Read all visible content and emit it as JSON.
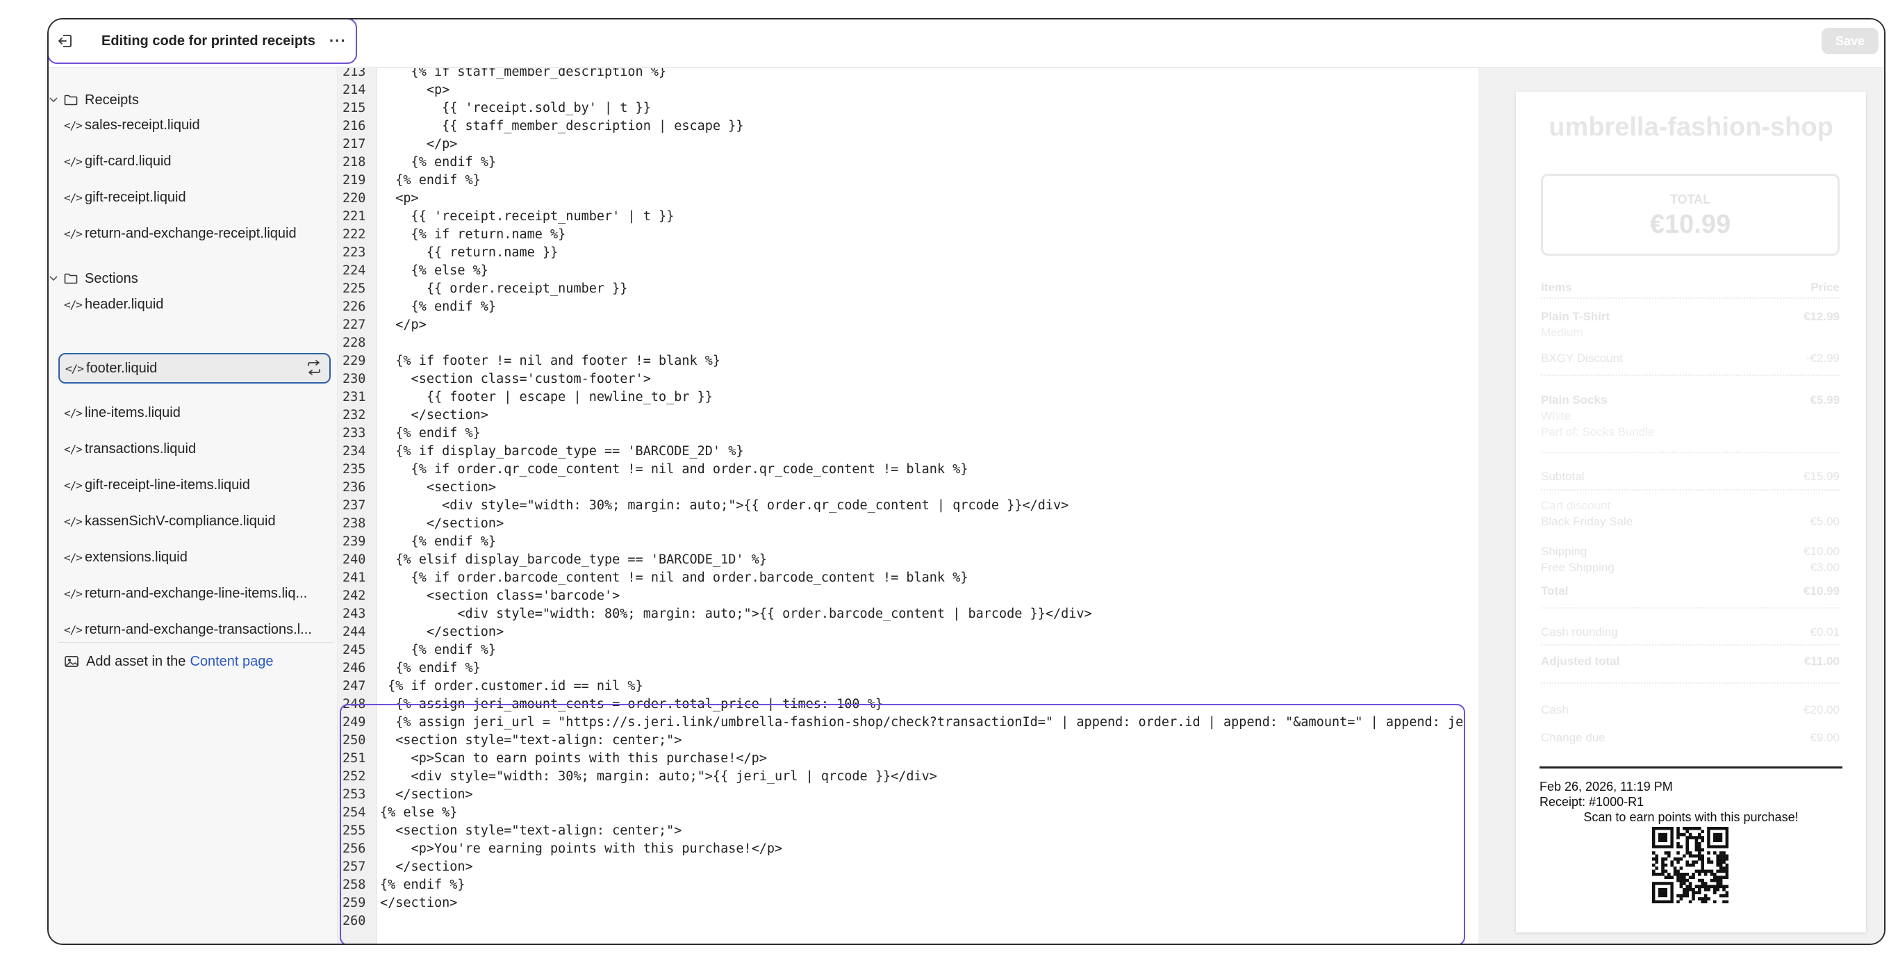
{
  "topbar": {
    "title": "Editing code for printed receipts",
    "more": "···",
    "save_label": "Save"
  },
  "sidebar": {
    "folders": [
      {
        "label": "Receipts"
      },
      {
        "label": "Sections"
      }
    ],
    "receipts_files": [
      "sales-receipt.liquid",
      "gift-card.liquid",
      "gift-receipt.liquid",
      "return-and-exchange-receipt.liquid"
    ],
    "sections_files": [
      "header.liquid",
      "footer.liquid",
      "line-items.liquid",
      "transactions.liquid",
      "gift-receipt-line-items.liquid",
      "kassenSichV-compliance.liquid",
      "extensions.liquid",
      "return-and-exchange-line-items.liq...",
      "return-and-exchange-transactions.l..."
    ],
    "code_icon": "</>",
    "add_asset_prefix": "Add asset in the",
    "add_asset_link": "Content page"
  },
  "editor": {
    "lines": [
      {
        "n": "213",
        "t": "    {% if staff_member_description %}"
      },
      {
        "n": "214",
        "t": "      <p>"
      },
      {
        "n": "215",
        "t": "        {{ 'receipt.sold_by' | t }}"
      },
      {
        "n": "216",
        "t": "        {{ staff_member_description | escape }}"
      },
      {
        "n": "217",
        "t": "      </p>"
      },
      {
        "n": "218",
        "t": "    {% endif %}"
      },
      {
        "n": "219",
        "t": "  {% endif %}"
      },
      {
        "n": "220",
        "t": "  <p>"
      },
      {
        "n": "221",
        "t": "    {{ 'receipt.receipt_number' | t }}"
      },
      {
        "n": "222",
        "t": "    {% if return.name %}"
      },
      {
        "n": "223",
        "t": "      {{ return.name }}"
      },
      {
        "n": "224",
        "t": "    {% else %}"
      },
      {
        "n": "225",
        "t": "      {{ order.receipt_number }}"
      },
      {
        "n": "226",
        "t": "    {% endif %}"
      },
      {
        "n": "227",
        "t": "  </p>"
      },
      {
        "n": "228",
        "t": ""
      },
      {
        "n": "229",
        "t": "  {% if footer != nil and footer != blank %}"
      },
      {
        "n": "230",
        "t": "    <section class='custom-footer'>"
      },
      {
        "n": "231",
        "t": "      {{ footer | escape | newline_to_br }}"
      },
      {
        "n": "232",
        "t": "    </section>"
      },
      {
        "n": "233",
        "t": "  {% endif %}"
      },
      {
        "n": "234",
        "t": "  {% if display_barcode_type == 'BARCODE_2D' %}"
      },
      {
        "n": "235",
        "t": "    {% if order.qr_code_content != nil and order.qr_code_content != blank %}"
      },
      {
        "n": "236",
        "t": "      <section>"
      },
      {
        "n": "237",
        "t": "        <div style=\"width: 30%; margin: auto;\">{{ order.qr_code_content | qrcode }}</div>"
      },
      {
        "n": "238",
        "t": "      </section>"
      },
      {
        "n": "239",
        "t": "    {% endif %}"
      },
      {
        "n": "240",
        "t": "  {% elsif display_barcode_type == 'BARCODE_1D' %}"
      },
      {
        "n": "241",
        "t": "    {% if order.barcode_content != nil and order.barcode_content != blank %}"
      },
      {
        "n": "242",
        "t": "      <section class='barcode'>"
      },
      {
        "n": "243",
        "t": "          <div style=\"width: 80%; margin: auto;\">{{ order.barcode_content | barcode }}</div>"
      },
      {
        "n": "244",
        "t": "      </section>"
      },
      {
        "n": "245",
        "t": "    {% endif %}"
      },
      {
        "n": "246",
        "t": "  {% endif %}"
      },
      {
        "n": "247",
        "t": " {% if order.customer.id == nil %}"
      },
      {
        "n": "248",
        "t": "  {% assign jeri_amount_cents = order.total_price | times: 100 %}"
      },
      {
        "n": "249",
        "t": "  {% assign jeri_url = \"https://s.jeri.link/umbrella-fashion-shop/check?transactionId=\" | append: order.id | append: \"&amount=\" | append: je"
      },
      {
        "n": "250",
        "t": "  <section style=\"text-align: center;\">"
      },
      {
        "n": "251",
        "t": "    <p>Scan to earn points with this purchase!</p>"
      },
      {
        "n": "252",
        "t": "    <div style=\"width: 30%; margin: auto;\">{{ jeri_url | qrcode }}</div>"
      },
      {
        "n": "253",
        "t": "  </section>"
      },
      {
        "n": "254",
        "t": "{% else %}"
      },
      {
        "n": "255",
        "t": "  <section style=\"text-align: center;\">"
      },
      {
        "n": "256",
        "t": "    <p>You're earning points with this purchase!</p>"
      },
      {
        "n": "257",
        "t": "  </section>"
      },
      {
        "n": "258",
        "t": "{% endif %}"
      },
      {
        "n": "259",
        "t": "</section>"
      },
      {
        "n": "260",
        "t": ""
      }
    ]
  },
  "receipt": {
    "shop_name": "umbrella-fashion-shop",
    "total_label": "TOTAL",
    "total_value": "€10.99",
    "items_header": "Items",
    "price_header": "Price",
    "item1_name": "Plain T-Shirt",
    "item1_variant": "Medium",
    "item1_price": "€12.99",
    "discount_label": "BXGY Discount",
    "discount_value": "-€2.99",
    "item2_name": "Plain Socks",
    "item2_variant": "White",
    "item2_bundle": "Part of: Socks Bundle",
    "item2_price": "€5.99",
    "subtotal_label": "Subtotal",
    "subtotal_value": "€15.99",
    "cart_discount_label": "Cart discount",
    "cart_discount_name": "Black Friday Sale",
    "cart_discount_value": "€5.00",
    "shipping_label": "Shipping",
    "shipping_value": "€10.00",
    "free_shipping_label": "Free Shipping",
    "free_shipping_value": "€3.00",
    "total_row_label": "Total",
    "total_row_value": "€10.99",
    "cash_rounding_label": "Cash rounding",
    "cash_rounding_value": "€0.01",
    "adjusted_total_label": "Adjusted total",
    "adjusted_total_value": "€11.00",
    "cash_label": "Cash",
    "cash_value": "€20.00",
    "change_label": "Change due",
    "change_value": "€9.00",
    "date": "Feb 26, 2026, 11:19 PM",
    "receipt_no": "Receipt: #1000-R1",
    "scan_text": "Scan to earn points with this purchase!"
  },
  "icons": {
    "exit": "exit-icon",
    "folder": "folder-icon",
    "chevron": "chevron-down-icon",
    "code": "code-icon",
    "swap": "swap-icon",
    "image": "image-icon",
    "qr": "qr-code-icon"
  }
}
